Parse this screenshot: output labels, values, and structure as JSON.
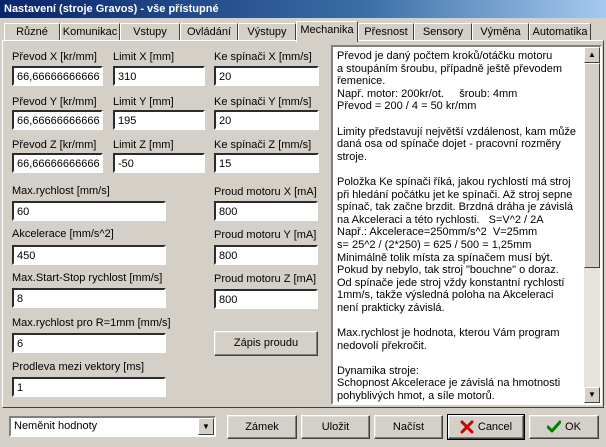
{
  "window": {
    "title": "Nastavení  (stroje  Gravos) - vše přístupné"
  },
  "tabs": [
    {
      "label": "Různé"
    },
    {
      "label": "Komunikac"
    },
    {
      "label": "Vstupy"
    },
    {
      "label": "Ovládání"
    },
    {
      "label": "Výstupy"
    },
    {
      "label": "Mechanika"
    },
    {
      "label": "Přesnost"
    },
    {
      "label": "Sensory"
    },
    {
      "label": "Výměna"
    },
    {
      "label": "Automatika"
    }
  ],
  "active_tab": "Mechanika",
  "mechanika": {
    "prevod_x": {
      "label": "Převod X [kr/mm]",
      "value": "66,66666666666"
    },
    "limit_x": {
      "label": "Limit X [mm]",
      "value": "310"
    },
    "spinac_x": {
      "label": "Ke spínači X [mm/s]",
      "value": "20"
    },
    "prevod_y": {
      "label": "Převod Y [kr/mm]",
      "value": "66,66666666666"
    },
    "limit_y": {
      "label": "Limit Y [mm]",
      "value": "195"
    },
    "spinac_y": {
      "label": "Ke spínači Y [mm/s]",
      "value": "20"
    },
    "prevod_z": {
      "label": "Převod Z [kr/mm]",
      "value": "66,66666666666"
    },
    "limit_z": {
      "label": "Limit Z [mm]",
      "value": "-50"
    },
    "spinac_z": {
      "label": "Ke spínači Z [mm/s]",
      "value": "15"
    },
    "max_rychlost": {
      "label": "Max.rychlost [mm/s]",
      "value": "60"
    },
    "proud_x": {
      "label": "Proud motoru X [mA]",
      "value": "800"
    },
    "akcelerace": {
      "label": "Akcelerace [mm/s^2]",
      "value": "450"
    },
    "proud_y": {
      "label": "Proud motoru Y [mA]",
      "value": "800"
    },
    "start_stop": {
      "label": "Max.Start-Stop rychlost [mm/s]",
      "value": "8"
    },
    "proud_z": {
      "label": "Proud motoru Z [mA]",
      "value": "800"
    },
    "rychlost_r": {
      "label": "Max.rychlost pro R=1mm [mm/s]",
      "value": "6"
    },
    "prodleva": {
      "label": "Prodleva mezi vektory [ms]",
      "value": "1"
    },
    "zapis_button": "Zápis proudu"
  },
  "info_text": "Převod je daný počtem kroků/otáčku motoru\na stoupáním šroubu, případně ještě převodem\nřemenice.\nNapř. motor: 200kr/ot.     šroub: 4mm\nPřevod = 200 / 4 = 50 kr/mm\n\nLimity představují největší vzdálenost, kam může\ndaná osa od spínače dojet - pracovní rozměry stroje.\n\nPoložka Ke spínači říká, jakou rychlostí má stroj\npři hledání počátku jet ke spínači. Až stroj sepne\nspínač, tak začne brzdit. Brzdná dráha je závislá\nna Akceleraci a této rychlosti.   S=V^2 / 2A\nNapř.: Akcelerace=250mm/s^2  V=25mm\ns= 25^2 / (2*250) = 625 / 500 = 1,25mm\nMinimálně tolik místa za spínačem musí být.\nPokud by nebylo, tak stroj \"bouchne\" o doraz.\nOd spínače jede stroj vždy konstantní rychlostí\n1mm/s, takže výsledná poloha na Akceleraci\nnení prakticky závislá.\n\nMax.rychlost je hodnota, kterou Vám program\nnedovolí překročit.\n\nDynamika stroje:\nSchopnost Akcelerace je závislá na hmotnosti\npohyblivých hmot, a síle motorů.",
  "bottom": {
    "mode_select": "Neměnit hodnoty",
    "zamek": "Zámek",
    "ulozit": "Uložit",
    "nacist": "Načíst",
    "cancel": "Cancel",
    "ok": "OK"
  },
  "colors": {
    "face": "#d4d0c8",
    "title_start": "#0a246a",
    "title_end": "#a6caf0",
    "cancel_icon": "#cc0000",
    "ok_icon": "#008000"
  }
}
